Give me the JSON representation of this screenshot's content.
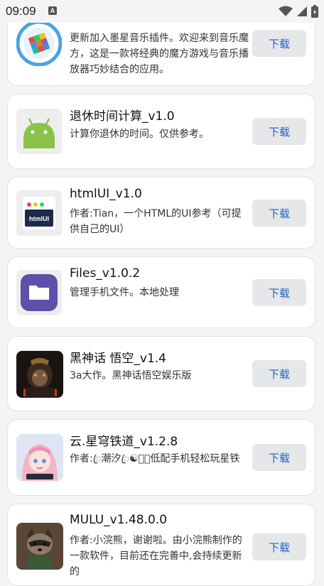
{
  "status": {
    "time": "09:09",
    "notif_letter": "A"
  },
  "apps": [
    {
      "title": "",
      "desc": "更新加入墨星音乐插件。欢迎来到音乐魔方，这是一款将经典的魔方游戏与音乐播放器巧妙结合的应用。",
      "button": "下载",
      "icon": "music-cube-icon"
    },
    {
      "title": "退休时间计算_v1.0",
      "desc": "计算你退休的时间。仅供参考。",
      "button": "下载",
      "icon": "android-icon"
    },
    {
      "title": "htmlUI_v1.0",
      "desc": "作者:Tian，一个HTML的UI参考（可提供自己的UI）",
      "button": "下载",
      "icon": "htmlui-icon",
      "icon_text": "htmlUI"
    },
    {
      "title": "Files_v1.0.2",
      "desc": "管理手机文件。本地处理",
      "button": "下载",
      "icon": "folder-icon"
    },
    {
      "title": "黑神话 悟空_v1.4",
      "desc": "3a大作。黑神话悟空娱乐版",
      "button": "下载",
      "icon": "wukong-icon"
    },
    {
      "title": "云.星穹铁道_v1.2.8",
      "desc": "作者:ꦿ潮汐ꦿ☯ꦿ，低配手机轻松玩星铁",
      "button": "下载",
      "icon": "anime-girl-icon"
    },
    {
      "title": "MULU_v1.48.0.0",
      "desc": "作者:小浣熊，谢谢啦。由小浣熊制作的一款软件，目前还在完善中,会持续更新的",
      "button": "下载",
      "icon": "raccoon-icon"
    }
  ]
}
